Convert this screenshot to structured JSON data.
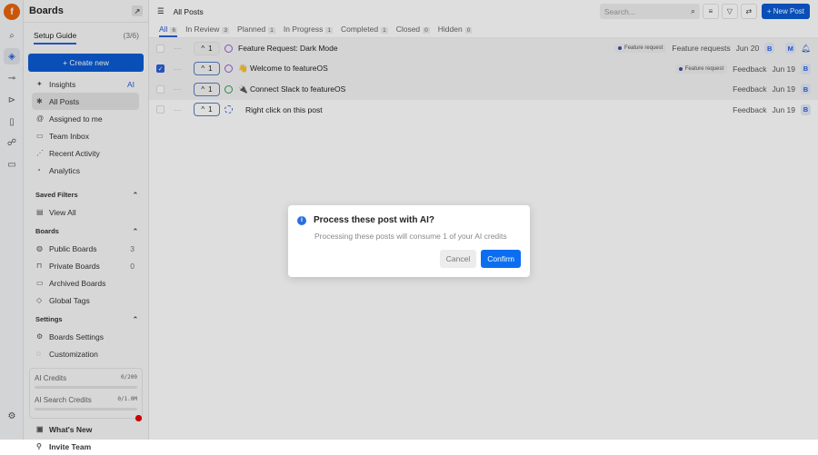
{
  "rail": {
    "icons": [
      "logo",
      "search-icon",
      "layers-icon",
      "roadmap-icon",
      "changelog-icon",
      "book-icon",
      "users-icon",
      "chat-icon",
      "settings-icon"
    ]
  },
  "sidebar": {
    "title": "Boards",
    "setup_guide": "Setup Guide",
    "setup_progress": "(3/6)",
    "create_new": "+ Create new",
    "items": [
      {
        "label": "Insights",
        "badge": "AI"
      },
      {
        "label": "All Posts"
      },
      {
        "label": "Assigned to me"
      },
      {
        "label": "Team Inbox"
      },
      {
        "label": "Recent Activity"
      },
      {
        "label": "Analytics"
      }
    ],
    "saved_filters": {
      "title": "Saved Filters",
      "items": [
        {
          "label": "View All"
        }
      ]
    },
    "boards": {
      "title": "Boards",
      "items": [
        {
          "label": "Public Boards",
          "count": "3"
        },
        {
          "label": "Private Boards",
          "count": "0"
        },
        {
          "label": "Archived Boards"
        },
        {
          "label": "Global Tags"
        }
      ]
    },
    "settings": {
      "title": "Settings",
      "items": [
        {
          "label": "Boards Settings"
        },
        {
          "label": "Customization"
        }
      ]
    },
    "credits": [
      {
        "label": "AI Credits",
        "value": "0/200",
        "fraction": 0
      },
      {
        "label": "AI Search Credits",
        "value": "0/1.0M",
        "fraction": 0
      }
    ],
    "footer": [
      {
        "label": "What's New"
      },
      {
        "label": "Invite Team"
      }
    ]
  },
  "header": {
    "title": "All Posts",
    "search_placeholder": "Search...",
    "new_post": "+ New Post"
  },
  "tabs": [
    {
      "label": "All",
      "count": "6"
    },
    {
      "label": "In Review",
      "count": "3"
    },
    {
      "label": "Planned",
      "count": "1"
    },
    {
      "label": "In Progress",
      "count": "1"
    },
    {
      "label": "Completed",
      "count": "1"
    },
    {
      "label": "Closed",
      "count": "0"
    },
    {
      "label": "Hidden",
      "count": "0"
    }
  ],
  "posts": [
    {
      "votes": "1",
      "title": "Feature Request: Dark Mode",
      "tag": "Feature request",
      "board": "Feature requests",
      "date": "Jun 20",
      "avatar": "B",
      "assignee": "M",
      "checked": false
    },
    {
      "votes": "1",
      "title": "👋 Welcome to featureOS",
      "tag": "Feature request",
      "board": "Feedback",
      "date": "Jun 19",
      "avatar": "B",
      "checked": true
    },
    {
      "votes": "1",
      "title": "🔌 Connect Slack to featureOS",
      "board": "Feedback",
      "date": "Jun 19",
      "avatar": "B",
      "checked": false
    },
    {
      "votes": "1",
      "title": "Right click on this post",
      "board": "Feedback",
      "date": "Jun 19",
      "avatar": "B",
      "checked": false
    }
  ],
  "modal": {
    "title": "Process these post with AI?",
    "description": "Processing these posts will consume 1 of your AI credits",
    "cancel": "Cancel",
    "confirm": "Confirm"
  }
}
